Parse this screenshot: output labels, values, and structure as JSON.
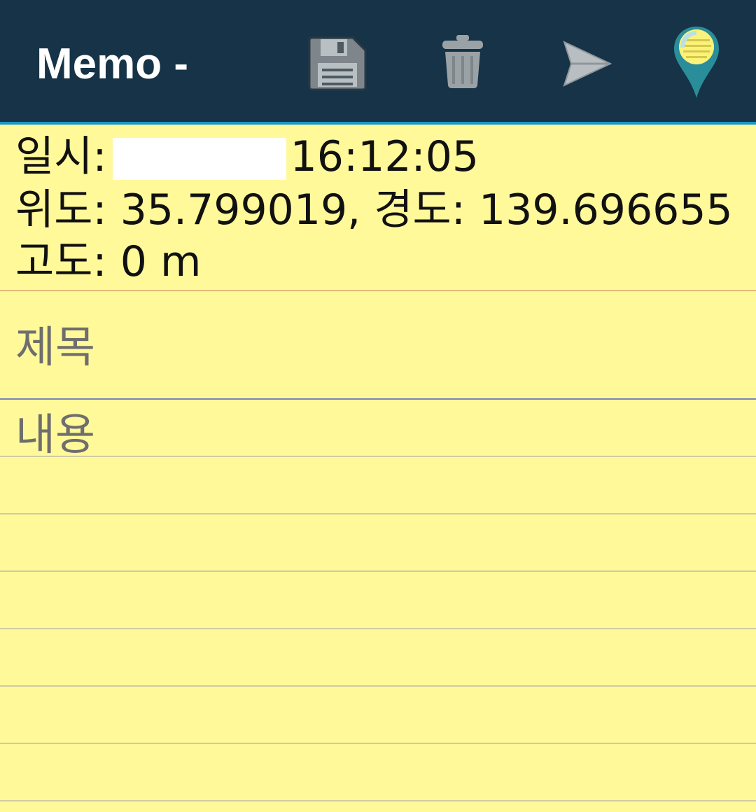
{
  "app_bar": {
    "title": "Memo -",
    "background": "#163347",
    "accent": "#1a97c7",
    "actions": [
      {
        "name": "save",
        "icon": "floppy-disk-icon"
      },
      {
        "name": "delete",
        "icon": "trash-can-icon"
      },
      {
        "name": "send",
        "icon": "paper-plane-icon"
      },
      {
        "name": "location",
        "icon": "map-pin-memo-icon"
      }
    ]
  },
  "info": {
    "datetime_label": "일시:",
    "time": "16:12:05",
    "latitude_label": "위도:",
    "latitude": "35.799019,",
    "longitude_label": "경도:",
    "longitude": "139.696655",
    "altitude_label": "고도:",
    "altitude": "0 m"
  },
  "memo": {
    "title_placeholder": "제목",
    "content_placeholder": "내용",
    "paper_color": "#fff99a"
  }
}
